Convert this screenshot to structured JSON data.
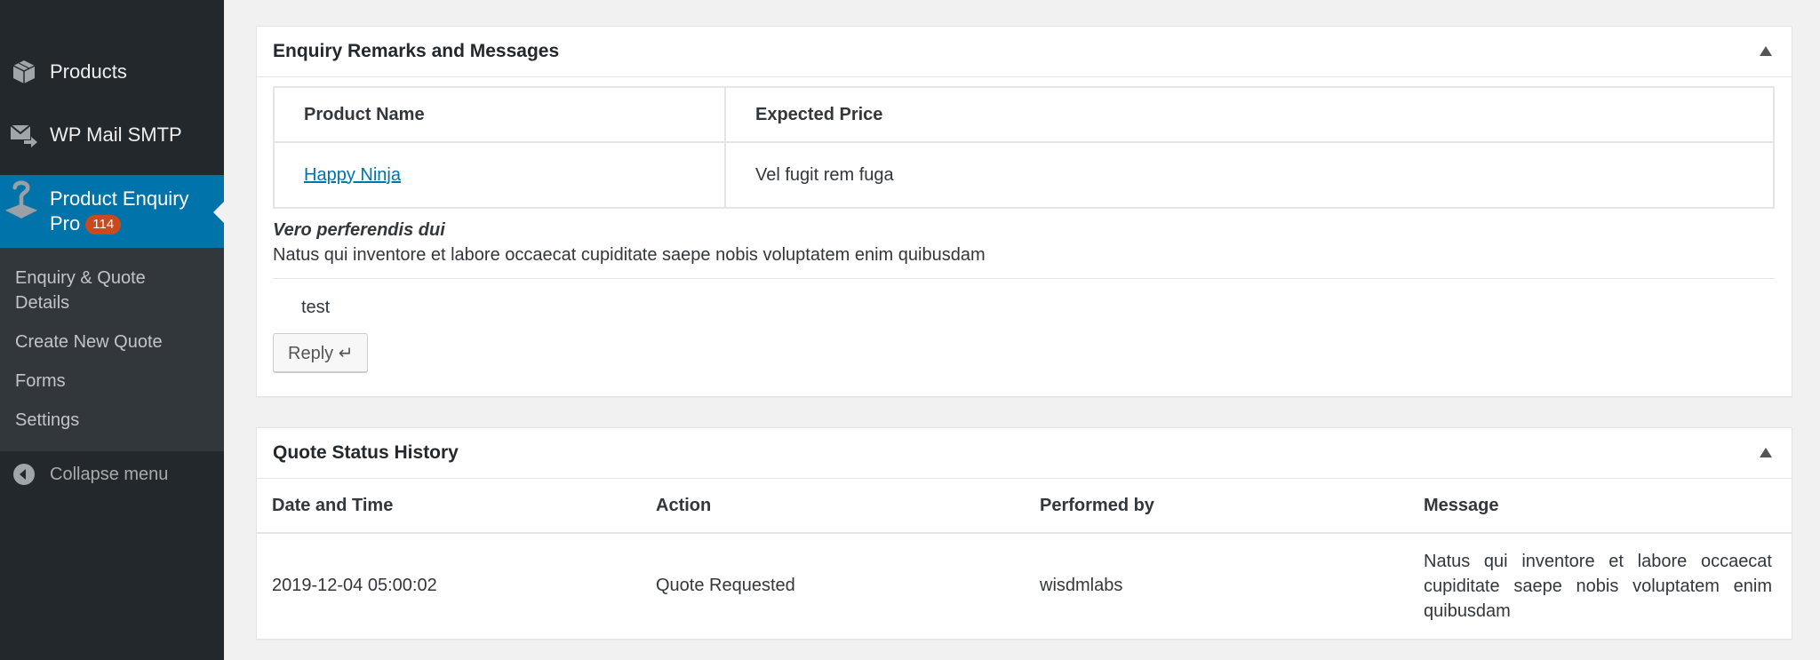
{
  "sidebar": {
    "items": [
      {
        "label": "Products",
        "icon": "box-icon"
      },
      {
        "label": "WP Mail SMTP",
        "icon": "mail-forward-icon"
      },
      {
        "label_line1": "Product Enquiry",
        "label_line2": "Pro",
        "badge": "114",
        "icon": "question-pin-icon",
        "active": true
      }
    ],
    "submenu": [
      {
        "label": "Enquiry & Quote Details"
      },
      {
        "label": "Create New Quote"
      },
      {
        "label": "Forms"
      },
      {
        "label": "Settings"
      }
    ],
    "collapse_label": "Collapse menu"
  },
  "remarks_panel": {
    "title": "Enquiry Remarks and Messages",
    "table": {
      "headers": [
        "Product Name",
        "Expected Price"
      ],
      "rows": [
        {
          "product": "Happy Ninja",
          "expected_price": "Vel fugit rem fuga"
        }
      ]
    },
    "remark_title": "Vero perferendis dui",
    "remark_body": "Natus qui inventore et labore occaecat cupiditate saepe nobis voluptatem enim quibusdam",
    "reply_text": "test",
    "reply_button": "Reply ↵"
  },
  "history_panel": {
    "title": "Quote Status History",
    "headers": [
      "Date and Time",
      "Action",
      "Performed by",
      "Message"
    ],
    "rows": [
      {
        "datetime": "2019-12-04 05:00:02",
        "action": "Quote Requested",
        "performed_by": "wisdmlabs",
        "message": "Natus qui inventore et labore occaecat cupiditate saepe nobis voluptatem enim quibusdam"
      }
    ]
  },
  "colors": {
    "sidebar_bg": "#23282d",
    "submenu_bg": "#32373c",
    "active_bg": "#0073aa",
    "badge_bg": "#ca4a1f",
    "link": "#0073aa"
  }
}
